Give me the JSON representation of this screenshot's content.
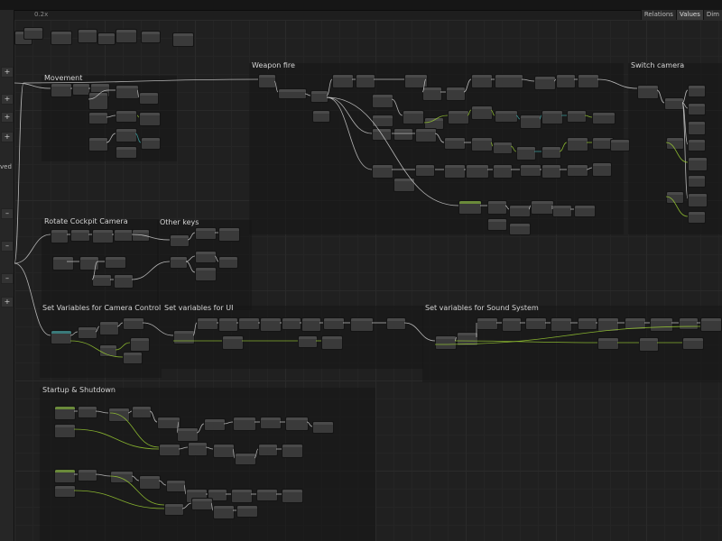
{
  "toolbar": {
    "zoom": "0.2x"
  },
  "inspector": {
    "tabs": [
      "Relations",
      "Values",
      "Dim"
    ]
  },
  "sidebar": {
    "buttons": [
      "+",
      "+",
      "+",
      "+",
      "–",
      "–",
      "–",
      "+"
    ],
    "partial_text": "ved"
  },
  "groups": [
    {
      "title": "Movement"
    },
    {
      "title": "Weapon fire"
    },
    {
      "title": "Switch camera"
    },
    {
      "title": "Rotate Cockpit Camera"
    },
    {
      "title": "Other keys"
    },
    {
      "title": "Set Variables for Camera Control"
    },
    {
      "title": "Set variables for UI"
    },
    {
      "title": "Set variables for Sound System"
    },
    {
      "title": "Startup & Shutdown"
    }
  ],
  "colors": {
    "background": "#1e1e1e",
    "node": "#3a3a3a",
    "flow_wire": "#cfcfcf",
    "value_wire": "#9acd32",
    "teal_wire": "#3fa7a7"
  }
}
